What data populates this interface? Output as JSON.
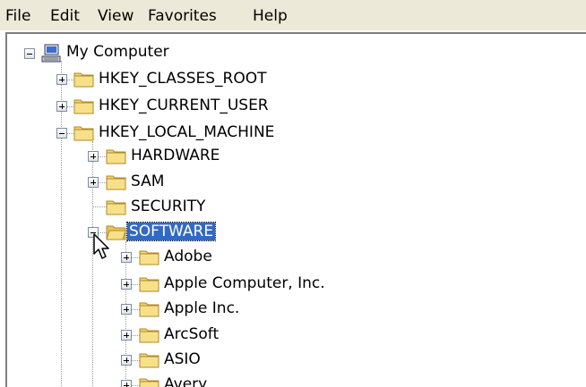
{
  "menu": {
    "file": "File",
    "edit": "Edit",
    "view": "View",
    "favorites": "Favorites",
    "help": "Help"
  },
  "tree": {
    "root": "My Computer",
    "hkcr": "HKEY_CLASSES_ROOT",
    "hkcu": "HKEY_CURRENT_USER",
    "hklm": "HKEY_LOCAL_MACHINE",
    "hardware": "HARDWARE",
    "sam": "SAM",
    "security": "SECURITY",
    "software": "SOFTWARE",
    "adobe": "Adobe",
    "apple_computer": "Apple Computer, Inc.",
    "apple_inc": "Apple Inc.",
    "arcsoft": "ArcSoft",
    "asio": "ASIO",
    "avery": "Avery"
  },
  "colors": {
    "selection": "#316ac5",
    "menubar": "#ece9d8",
    "folder": "#f2d46a"
  }
}
